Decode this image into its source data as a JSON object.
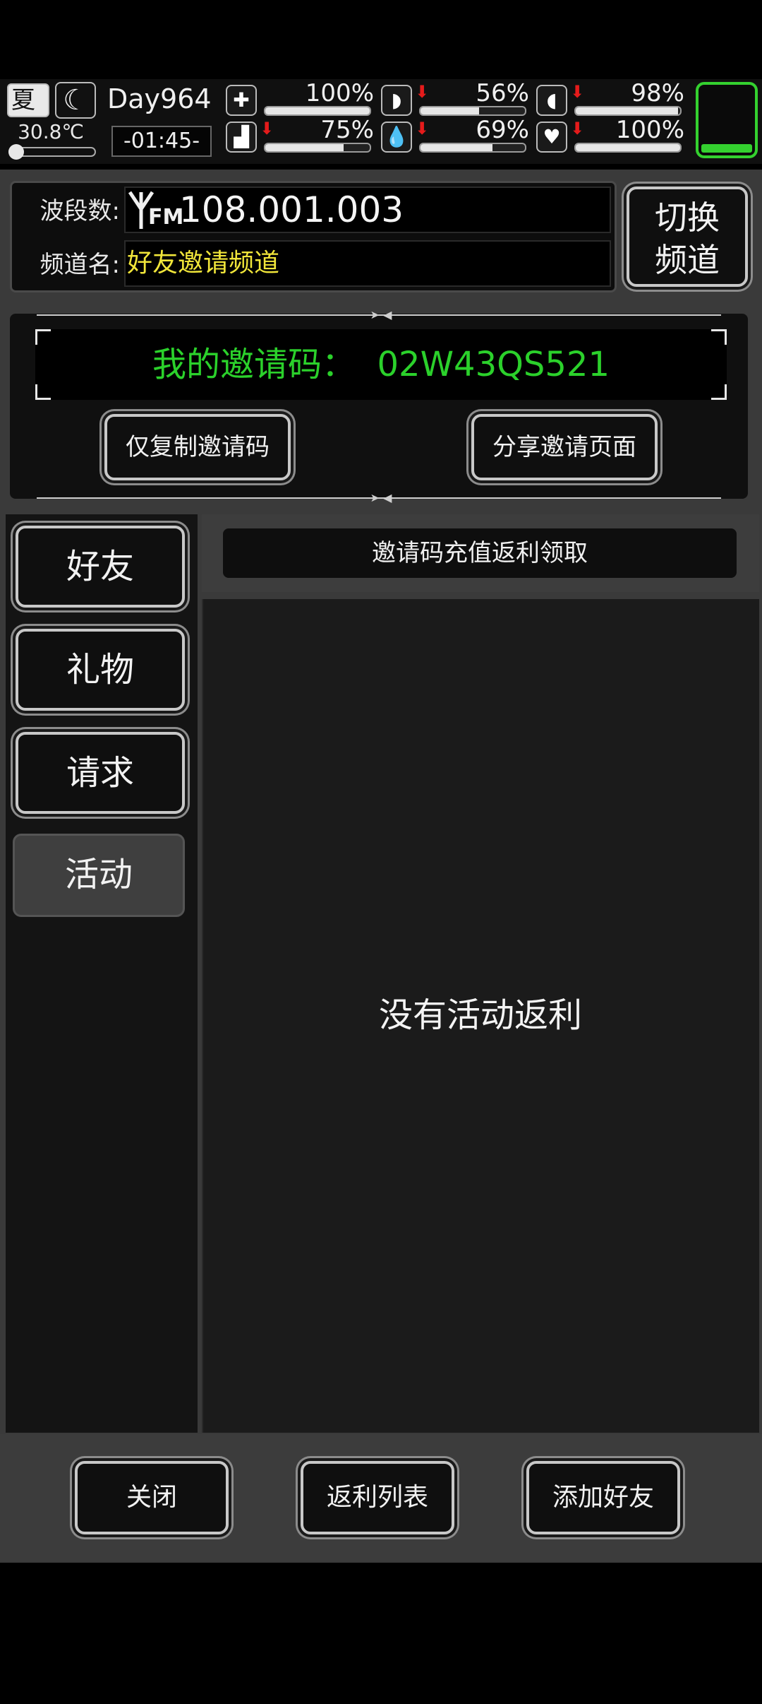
{
  "hud": {
    "season": "夏",
    "temperature": "30.8℃",
    "day": "Day964",
    "time": "-01:45-",
    "stats": [
      {
        "icon": "medkit-icon",
        "glyph": "✚",
        "value": "100%",
        "level": 1.0,
        "down": false
      },
      {
        "icon": "stomach-icon",
        "glyph": "◗",
        "value": "56%",
        "level": 0.56,
        "down": true
      },
      {
        "icon": "pill-icon",
        "glyph": "◖",
        "value": "98%",
        "level": 0.98,
        "down": true
      },
      {
        "icon": "foot-icon",
        "glyph": "▟",
        "value": "75%",
        "level": 0.75,
        "down": true
      },
      {
        "icon": "water-drop-icon",
        "glyph": "💧",
        "value": "69%",
        "level": 0.69,
        "down": true
      },
      {
        "icon": "heart-icon",
        "glyph": "♥",
        "value": "100%",
        "level": 1.0,
        "down": true
      }
    ],
    "battery_color": "#34d12f"
  },
  "radio": {
    "freq_label": "波段数:",
    "fm": "FM",
    "freq_value": "108.001.003",
    "channel_label": "频道名:",
    "channel_name": "好友邀请频道",
    "switch_button": "切换\n频道"
  },
  "invite": {
    "code_text": "我的邀请码：  02W43QS521",
    "copy_button": "仅复制邀请码",
    "share_button": "分享邀请页面"
  },
  "sidebar": {
    "items": [
      {
        "label": "好友"
      },
      {
        "label": "礼物"
      },
      {
        "label": "请求"
      },
      {
        "label": "活动"
      }
    ]
  },
  "content": {
    "tab": "邀请码充值返利领取",
    "empty": "没有活动返利"
  },
  "bottom": {
    "close": "关闭",
    "rebate_list": "返利列表",
    "add_friend": "添加好友"
  }
}
